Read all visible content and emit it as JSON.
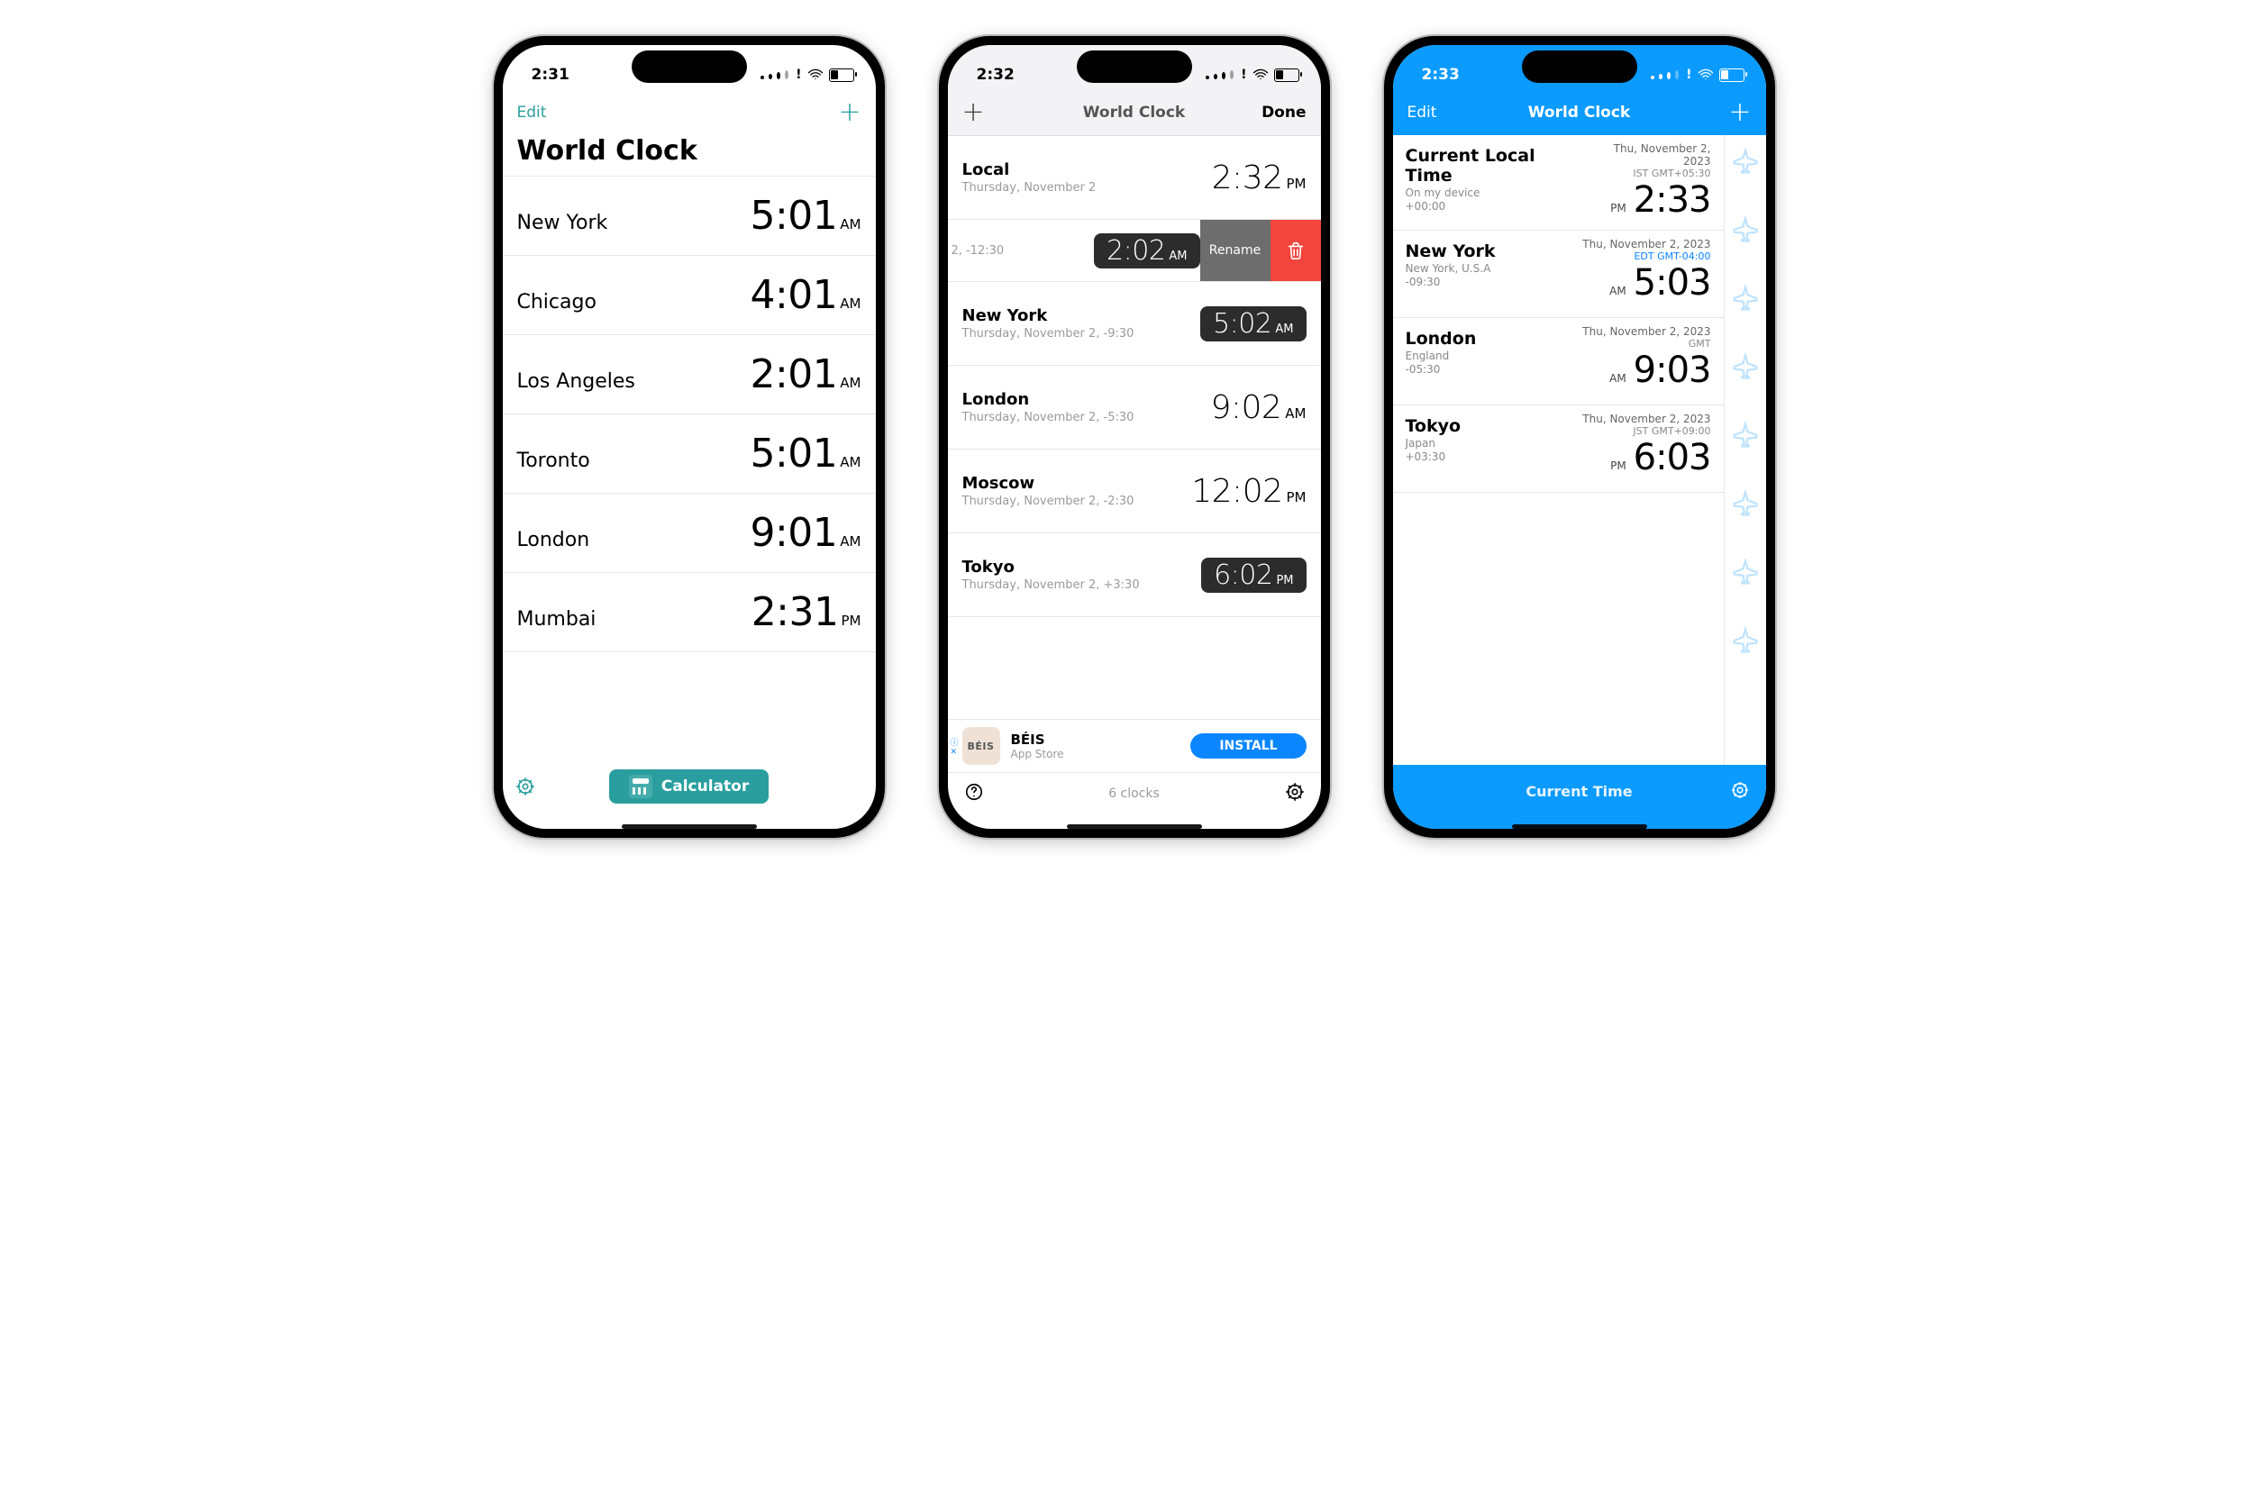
{
  "colors": {
    "teal": "#2a9e9e",
    "blue": "#0b9bff",
    "red": "#f2453d",
    "darkPill": "#2c2c2c"
  },
  "phone1": {
    "status_time": "2:31",
    "nav": {
      "edit": "Edit"
    },
    "title": "World Clock",
    "rows": [
      {
        "city": "New York",
        "time": "5:01",
        "ap": "AM"
      },
      {
        "city": "Chicago",
        "time": "4:01",
        "ap": "AM"
      },
      {
        "city": "Los Angeles",
        "time": "2:01",
        "ap": "AM"
      },
      {
        "city": "Toronto",
        "time": "5:01",
        "ap": "AM"
      },
      {
        "city": "London",
        "time": "9:01",
        "ap": "AM"
      },
      {
        "city": "Mumbai",
        "time": "2:31",
        "ap": "PM"
      }
    ],
    "calculator_label": "Calculator"
  },
  "phone2": {
    "status_time": "2:32",
    "nav": {
      "title": "World Clock",
      "done": "Done"
    },
    "rows": [
      {
        "city": "Local",
        "sub": "Thursday, November 2",
        "time": "2:32",
        "ap": "PM",
        "dark": false
      },
      {
        "city_hidden": true,
        "peek": "2, -12:30",
        "time": "2:02",
        "ap": "AM",
        "dark": true,
        "swipe": true,
        "rename_label": "Rename"
      },
      {
        "city": "New York",
        "sub": "Thursday, November 2, -9:30",
        "time": "5:02",
        "ap": "AM",
        "dark": true
      },
      {
        "city": "London",
        "sub": "Thursday, November 2, -5:30",
        "time": "9:02",
        "ap": "AM",
        "dark": false
      },
      {
        "city": "Moscow",
        "sub": "Thursday, November 2, -2:30",
        "time": "12:02",
        "ap": "PM",
        "dark": false
      },
      {
        "city": "Tokyo",
        "sub": "Thursday, November 2, +3:30",
        "time": "6:02",
        "ap": "PM",
        "dark": true
      }
    ],
    "ad": {
      "brand_logo": "BÉIS",
      "title": "BÉIS",
      "subtitle": "App Store",
      "cta": "INSTALL"
    },
    "footer": {
      "count": "6 clocks"
    }
  },
  "phone3": {
    "status_time": "2:33",
    "nav": {
      "edit": "Edit",
      "title": "World Clock"
    },
    "rows": [
      {
        "city": "Current Local Time",
        "sub": "On my device",
        "off": "+00:00",
        "date": "Thu, November 2, 2023",
        "tz": "IST GMT+05:30",
        "tz_blue": false,
        "ap": "PM",
        "time": "2:33"
      },
      {
        "city": "New York",
        "sub": "New York, U.S.A",
        "off": "-09:30",
        "date": "Thu, November 2, 2023",
        "tz": "EDT GMT-04:00",
        "tz_blue": true,
        "ap": "AM",
        "time": "5:03"
      },
      {
        "city": "London",
        "sub": "England",
        "off": "-05:30",
        "date": "Thu, November 2, 2023",
        "tz": "GMT",
        "tz_blue": false,
        "ap": "AM",
        "time": "9:03"
      },
      {
        "city": "Tokyo",
        "sub": "Japan",
        "off": "+03:30",
        "date": "Thu, November 2, 2023",
        "tz": "JST GMT+09:00",
        "tz_blue": false,
        "ap": "PM",
        "time": "6:03"
      }
    ],
    "footer": {
      "label": "Current Time"
    }
  }
}
